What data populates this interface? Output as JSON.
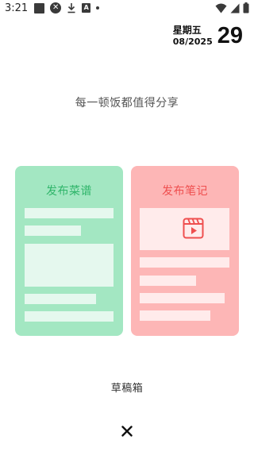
{
  "status_bar": {
    "time": "3:21",
    "icons": [
      "square-icon",
      "close-circle-icon",
      "download-icon",
      "font-icon",
      "dot-icon"
    ],
    "right_icons": [
      "wifi-icon",
      "signal-icon",
      "battery-icon"
    ]
  },
  "date": {
    "weekday": "星期五",
    "month_year": "08/2025",
    "day": "29"
  },
  "tagline": "每一顿饭都值得分享",
  "cards": {
    "recipe": {
      "title": "发布菜谱",
      "color": "#a3e7c2",
      "title_color": "#2fb56a"
    },
    "note": {
      "title": "发布笔记",
      "color": "#fdb6b6",
      "title_color": "#ef4f4f",
      "icon": "video-clapper-icon"
    }
  },
  "drafts_label": "草稿箱",
  "close_icon": "close-icon"
}
